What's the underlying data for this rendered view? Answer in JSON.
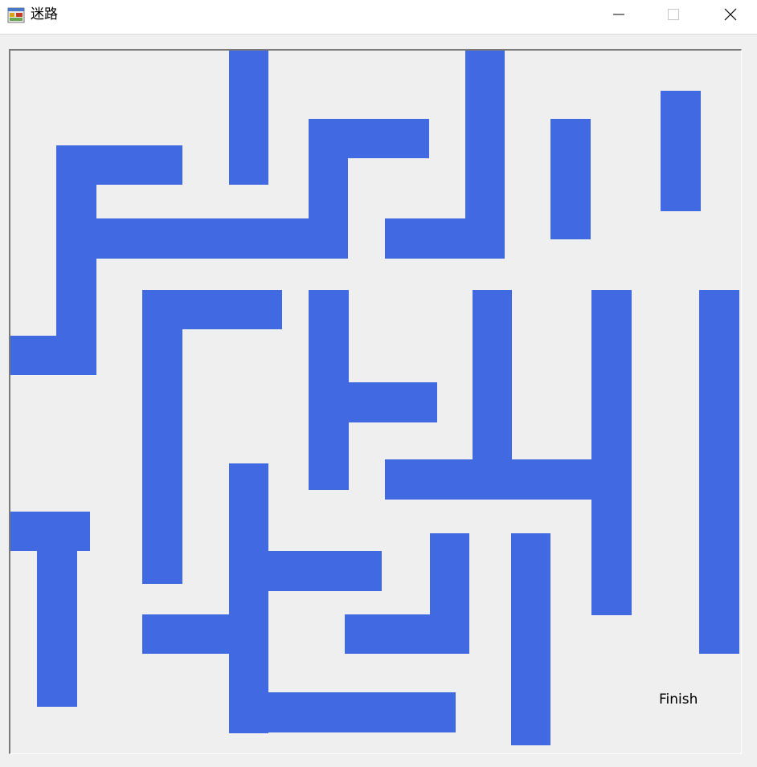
{
  "window": {
    "title": "迷路",
    "icons": {
      "app": "app-form-icon",
      "minimize": "minimize-icon",
      "maximize": "maximize-icon",
      "close": "close-icon"
    }
  },
  "maze": {
    "wall_color": "#4169E1",
    "background_color": "#EFEFEF",
    "wall_count": 33,
    "finish_label": "Finish"
  }
}
